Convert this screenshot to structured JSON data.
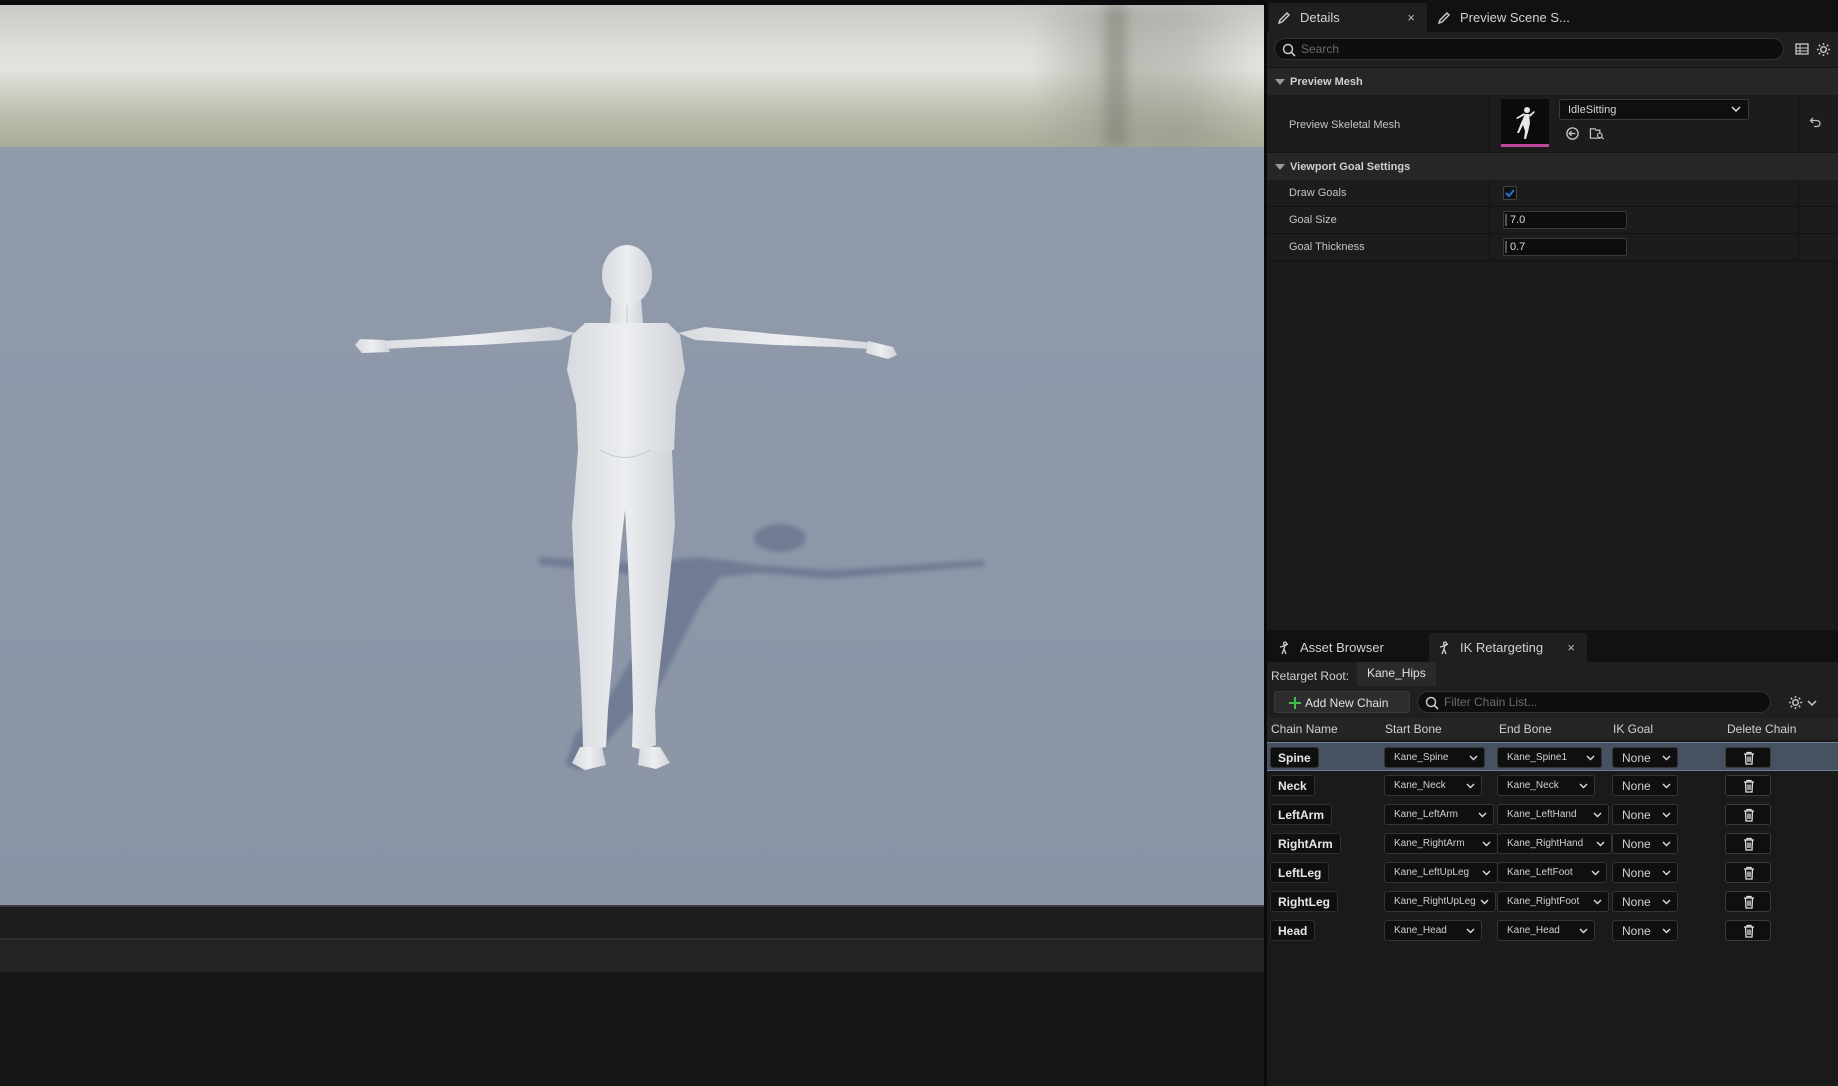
{
  "details_tabs": [
    {
      "label": "Details",
      "close": "×"
    },
    {
      "label": "Preview Scene S..."
    }
  ],
  "details_search": {
    "placeholder": "Search"
  },
  "preview_mesh": {
    "section_title": "Preview Mesh",
    "label": "Preview Skeletal Mesh",
    "value": "IdleSitting"
  },
  "goal_settings": {
    "section_title": "Viewport Goal Settings",
    "draw_goals": {
      "label": "Draw Goals",
      "checked": true
    },
    "goal_size": {
      "label": "Goal Size",
      "value": "7.0"
    },
    "goal_thickness": {
      "label": "Goal Thickness",
      "value": "0.7"
    }
  },
  "bottom_tabs": [
    {
      "label": "Asset Browser"
    },
    {
      "label": "IK Retargeting",
      "close": "×"
    }
  ],
  "retarget": {
    "root_label": "Retarget Root:",
    "root_value": "Kane_Hips",
    "add_button": "Add New Chain",
    "filter_placeholder": "Filter Chain List..."
  },
  "chain_columns": [
    "Chain Name",
    "Start Bone",
    "End Bone",
    "IK Goal",
    "Delete Chain"
  ],
  "chains": [
    {
      "name": "Spine",
      "start": "Kane_Spine",
      "end": "Kane_Spine1",
      "goal": "None"
    },
    {
      "name": "Neck",
      "start": "Kane_Neck",
      "end": "Kane_Neck",
      "goal": "None"
    },
    {
      "name": "LeftArm",
      "start": "Kane_LeftArm",
      "end": "Kane_LeftHand",
      "goal": "None"
    },
    {
      "name": "RightArm",
      "start": "Kane_RightArm",
      "end": "Kane_RightHand",
      "goal": "None"
    },
    {
      "name": "LeftLeg",
      "start": "Kane_LeftUpLeg",
      "end": "Kane_LeftFoot",
      "goal": "None"
    },
    {
      "name": "RightLeg",
      "start": "Kane_RightUpLeg",
      "end": "Kane_RightFoot",
      "goal": "None"
    },
    {
      "name": "Head",
      "start": "Kane_Head",
      "end": "Kane_Head",
      "goal": "None"
    }
  ],
  "colors": {
    "viewport_floor": "#8e96a6",
    "selection_row": "#465262",
    "checkbox": "#2f6fd8",
    "add_icon": "#3fbf4a",
    "mesh_underline": "#c0489a"
  },
  "icons": [
    "pencil-icon",
    "close-icon",
    "search-icon",
    "grid-icon",
    "gear-icon",
    "reset-icon",
    "browse-icon",
    "find-icon",
    "mannequin-icon",
    "plus-icon",
    "trash-icon",
    "chevron-down-icon"
  ]
}
